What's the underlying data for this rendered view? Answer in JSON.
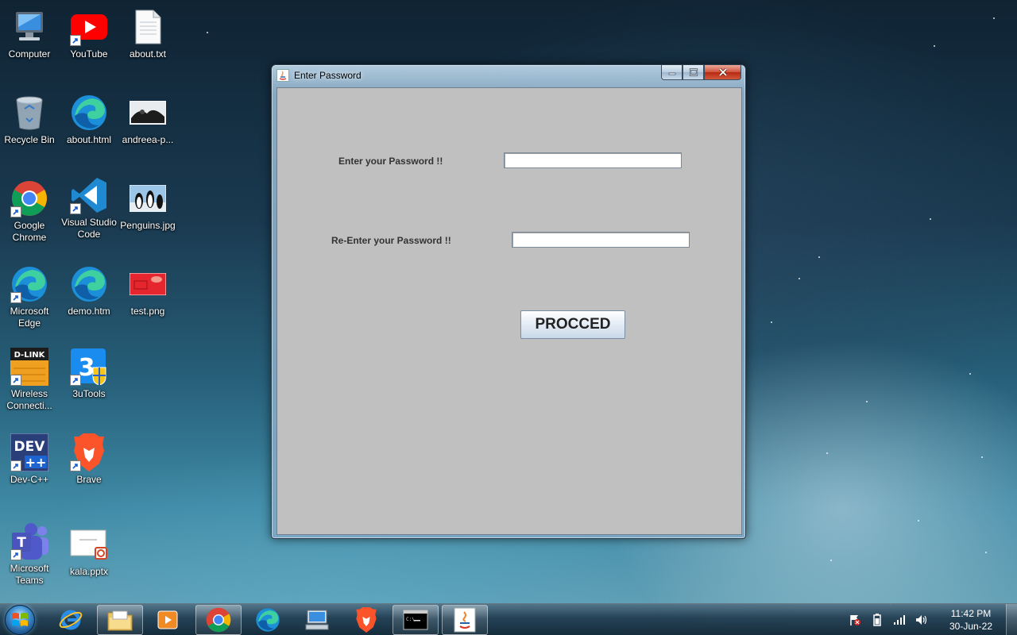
{
  "desktop": {
    "icons": [
      {
        "label": "Computer"
      },
      {
        "label": "YouTube"
      },
      {
        "label": "about.txt"
      },
      {
        "label": "Recycle Bin"
      },
      {
        "label": "about.html"
      },
      {
        "label": "andreea-p..."
      },
      {
        "label": "Google Chrome"
      },
      {
        "label": "Visual Studio Code"
      },
      {
        "label": "Penguins.jpg"
      },
      {
        "label": "Microsoft Edge"
      },
      {
        "label": "demo.htm"
      },
      {
        "label": "test.png"
      },
      {
        "label": "Wireless Connecti..."
      },
      {
        "label": "3uTools"
      },
      {
        "label": "Dev-C++"
      },
      {
        "label": "Brave"
      },
      {
        "label": "Microsoft Teams"
      },
      {
        "label": "kala.pptx"
      }
    ]
  },
  "window": {
    "title": "Enter Password",
    "password_label": "Enter your Password !!",
    "password_value": "",
    "reenter_label": "Re-Enter your Password !!",
    "reenter_value": "",
    "proceed_label": "PROCCED"
  },
  "taskbar": {
    "pinned": [
      "windows-explorer",
      "internet-explorer",
      "file-explorer",
      "media-player",
      "google-chrome",
      "microsoft-edge",
      "remote-desktop",
      "brave",
      "command-prompt",
      "java"
    ],
    "clock_time": "11:42 PM",
    "clock_date": "30-Jun-22"
  },
  "colors": {
    "client_bg": "#c0c0c0",
    "label_text": "#333333",
    "close_button": "#c8432a"
  }
}
